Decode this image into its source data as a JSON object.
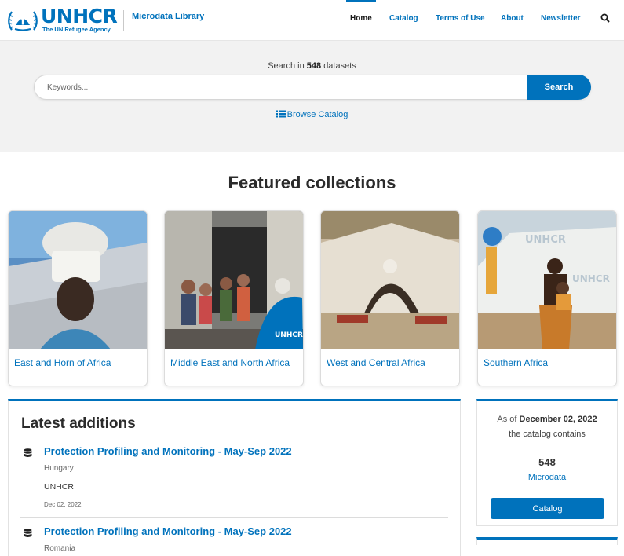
{
  "header": {
    "logo_word": "UNHCR",
    "logo_sub": "The UN Refugee Agency",
    "site_title": "Microdata Library",
    "nav": [
      {
        "label": "Home",
        "active": true
      },
      {
        "label": "Catalog",
        "active": false
      },
      {
        "label": "Terms of Use",
        "active": false
      },
      {
        "label": "About",
        "active": false
      },
      {
        "label": "Newsletter",
        "active": false
      }
    ],
    "search_icon": "search-icon"
  },
  "search": {
    "prefix": "Search in",
    "count": "548",
    "suffix": "datasets",
    "placeholder": "Keywords...",
    "button_label": "Search",
    "browse_label": "Browse Catalog",
    "browse_icon": "list-icon"
  },
  "featured": {
    "title": "Featured collections",
    "collections": [
      {
        "label": "East and Horn of Africa"
      },
      {
        "label": "Middle East and North Africa"
      },
      {
        "label": "West and Central Africa"
      },
      {
        "label": "Southern Africa"
      }
    ]
  },
  "latest": {
    "title": "Latest additions",
    "items": [
      {
        "title": "Protection Profiling and Monitoring - May-Sep 2022",
        "country": "Hungary",
        "org": "UNHCR",
        "date": "Dec 02, 2022",
        "icon": "database-icon"
      },
      {
        "title": "Protection Profiling and Monitoring - May-Sep 2022",
        "country": "Romania",
        "org": "",
        "date": "",
        "icon": "database-icon"
      }
    ]
  },
  "stats": {
    "asof_prefix": "As of",
    "asof_date": "December 02, 2022",
    "contains": "the catalog contains",
    "count": "548",
    "unit": "Microdata",
    "button_label": "Catalog"
  },
  "colors": {
    "brand": "#0072bc",
    "band": "#f2f2f2"
  }
}
